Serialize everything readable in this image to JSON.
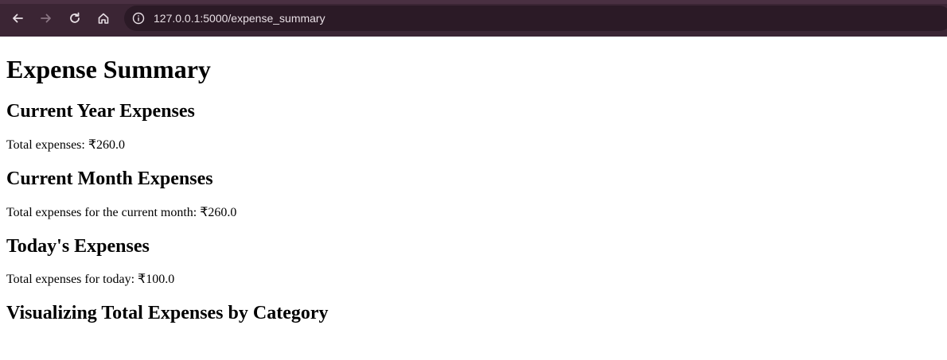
{
  "browser": {
    "url": "127.0.0.1:5000/expense_summary"
  },
  "page": {
    "title": "Expense Summary",
    "sections": [
      {
        "heading": "Current Year Expenses",
        "text": "Total expenses: ₹260.0"
      },
      {
        "heading": "Current Month Expenses",
        "text": "Total expenses for the current month: ₹260.0"
      },
      {
        "heading": "Today's Expenses",
        "text": "Total expenses for today: ₹100.0"
      },
      {
        "heading": "Visualizing Total Expenses by Category"
      }
    ]
  },
  "colors": {
    "toolbar_bg": "#3b2534",
    "address_bar_bg": "#2b1a26",
    "icon_color": "#e8dfe5",
    "disabled_icon_color": "#8a7583"
  }
}
